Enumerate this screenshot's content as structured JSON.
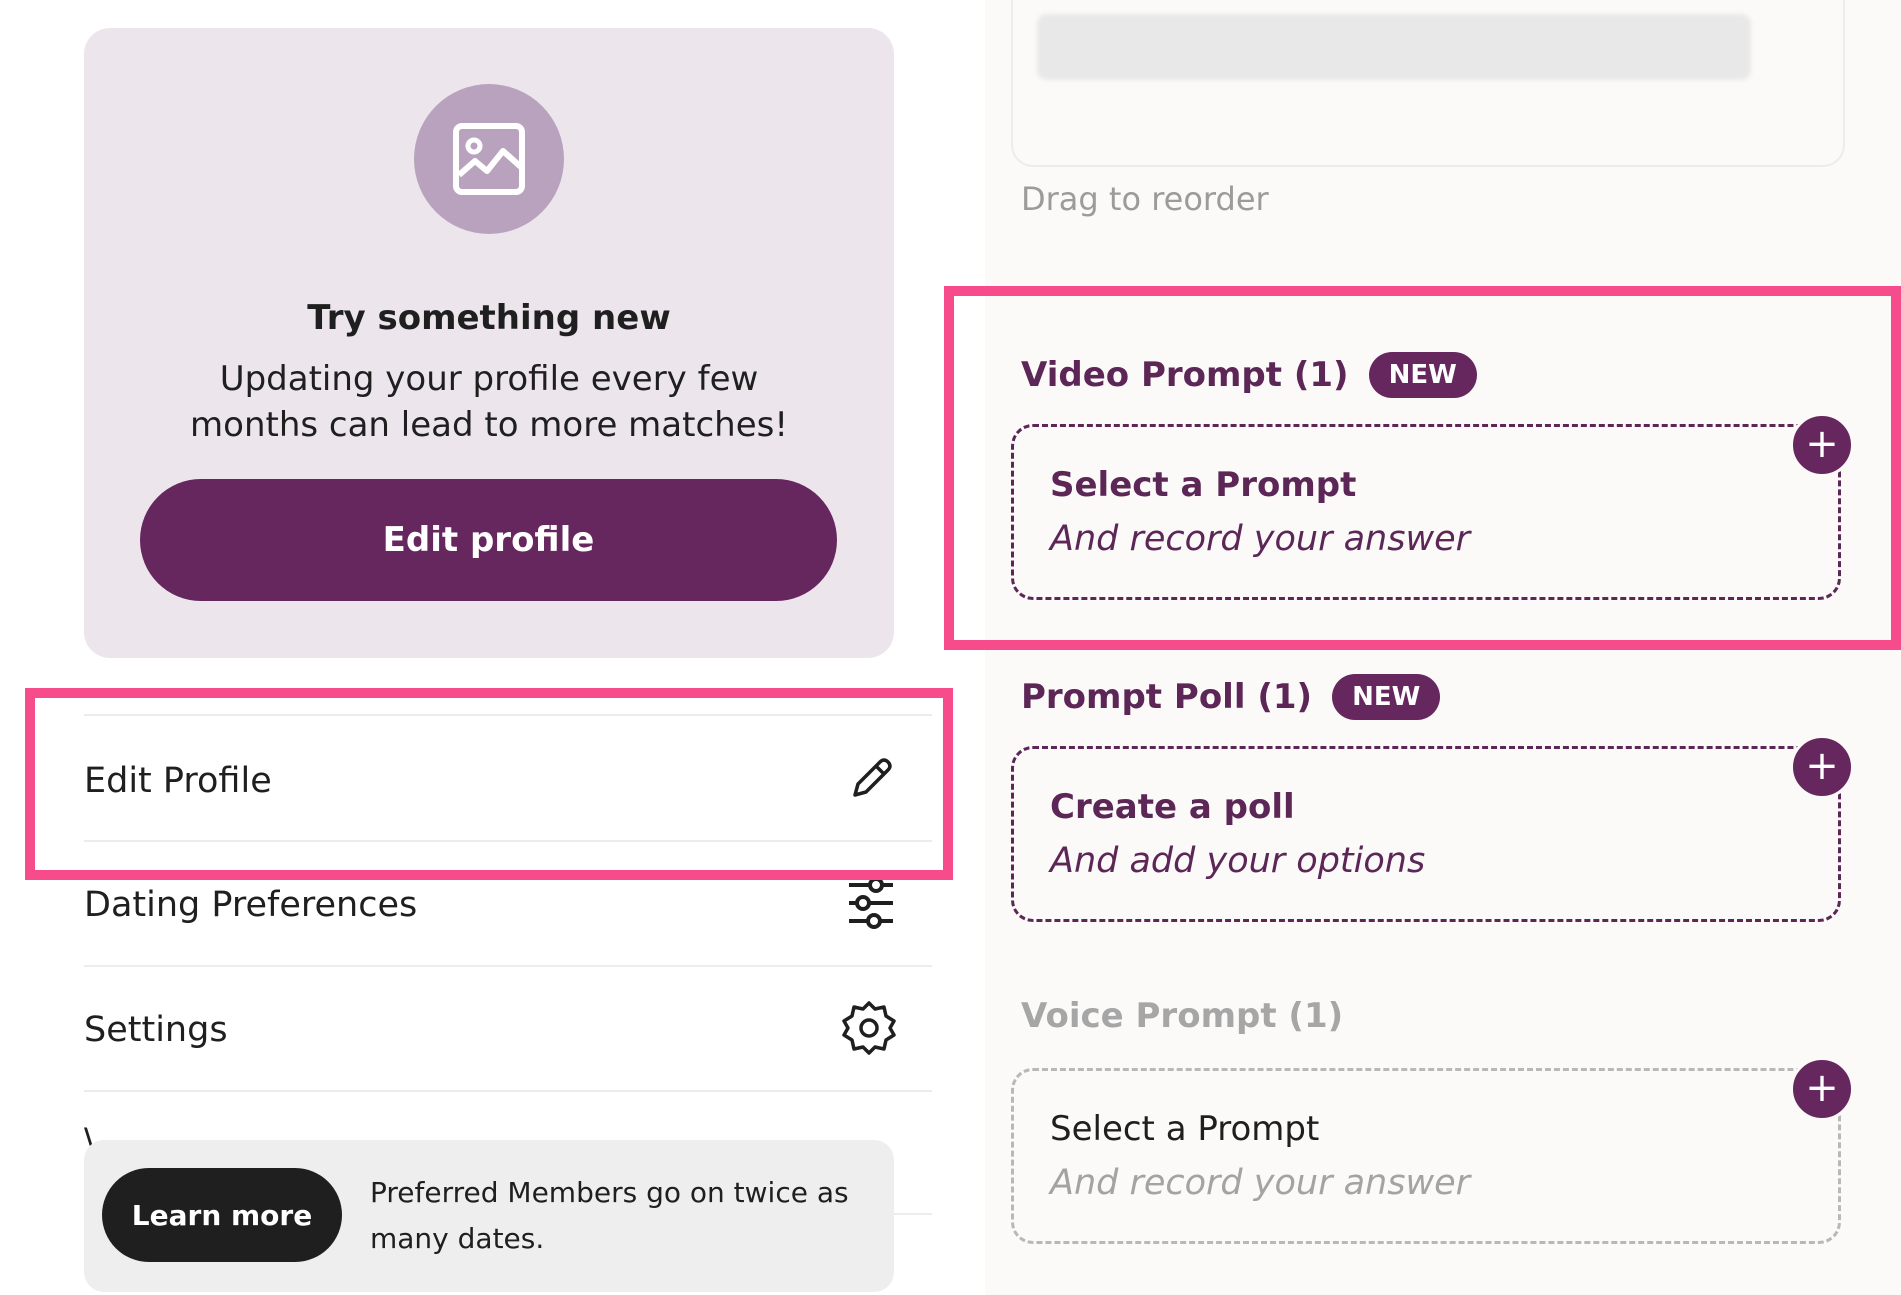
{
  "promo_card": {
    "icon": "photo-icon",
    "title": "Try something new",
    "body": "Updating your profile every few months can lead to more matches!",
    "button_label": "Edit profile"
  },
  "menu": {
    "items": [
      {
        "label": "Edit Profile",
        "icon": "pencil-icon"
      },
      {
        "label": "Dating Preferences",
        "icon": "sliders-icon"
      },
      {
        "label": "Settings",
        "icon": "gear-icon"
      }
    ]
  },
  "toast": {
    "button_label": "Learn more",
    "message": "Preferred Members go on twice as many dates."
  },
  "media": {
    "drag_hint": "Drag to reorder"
  },
  "sections": {
    "video": {
      "title": "Video Prompt (1)",
      "badge": "NEW",
      "main": "Select a Prompt",
      "sub": "And record your answer"
    },
    "poll": {
      "title": "Prompt Poll (1)",
      "badge": "NEW",
      "main": "Create a poll",
      "sub": "And add your options"
    },
    "voice": {
      "title": "Voice Prompt (1)",
      "main": "Select a Prompt",
      "sub": "And record your answer"
    },
    "plus_label": "+"
  },
  "colors": {
    "brand": "#66275e",
    "highlight": "#f74c8c",
    "card_bg": "#ece6ec"
  }
}
